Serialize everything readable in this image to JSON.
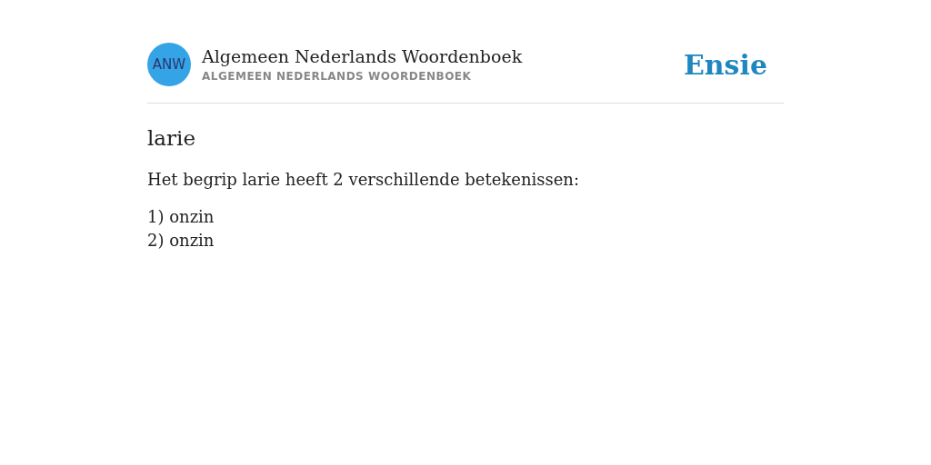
{
  "header": {
    "logo_text": "ANW",
    "title": "Algemeen Nederlands Woordenboek",
    "subtitle": "ALGEMEEN NEDERLANDS WOORDENBOEK",
    "brand": "Ensie"
  },
  "entry": {
    "term": "larie",
    "intro": "Het begrip larie heeft 2 verschillende betekenissen:",
    "meanings": [
      "1) onzin",
      "2) onzin"
    ]
  }
}
